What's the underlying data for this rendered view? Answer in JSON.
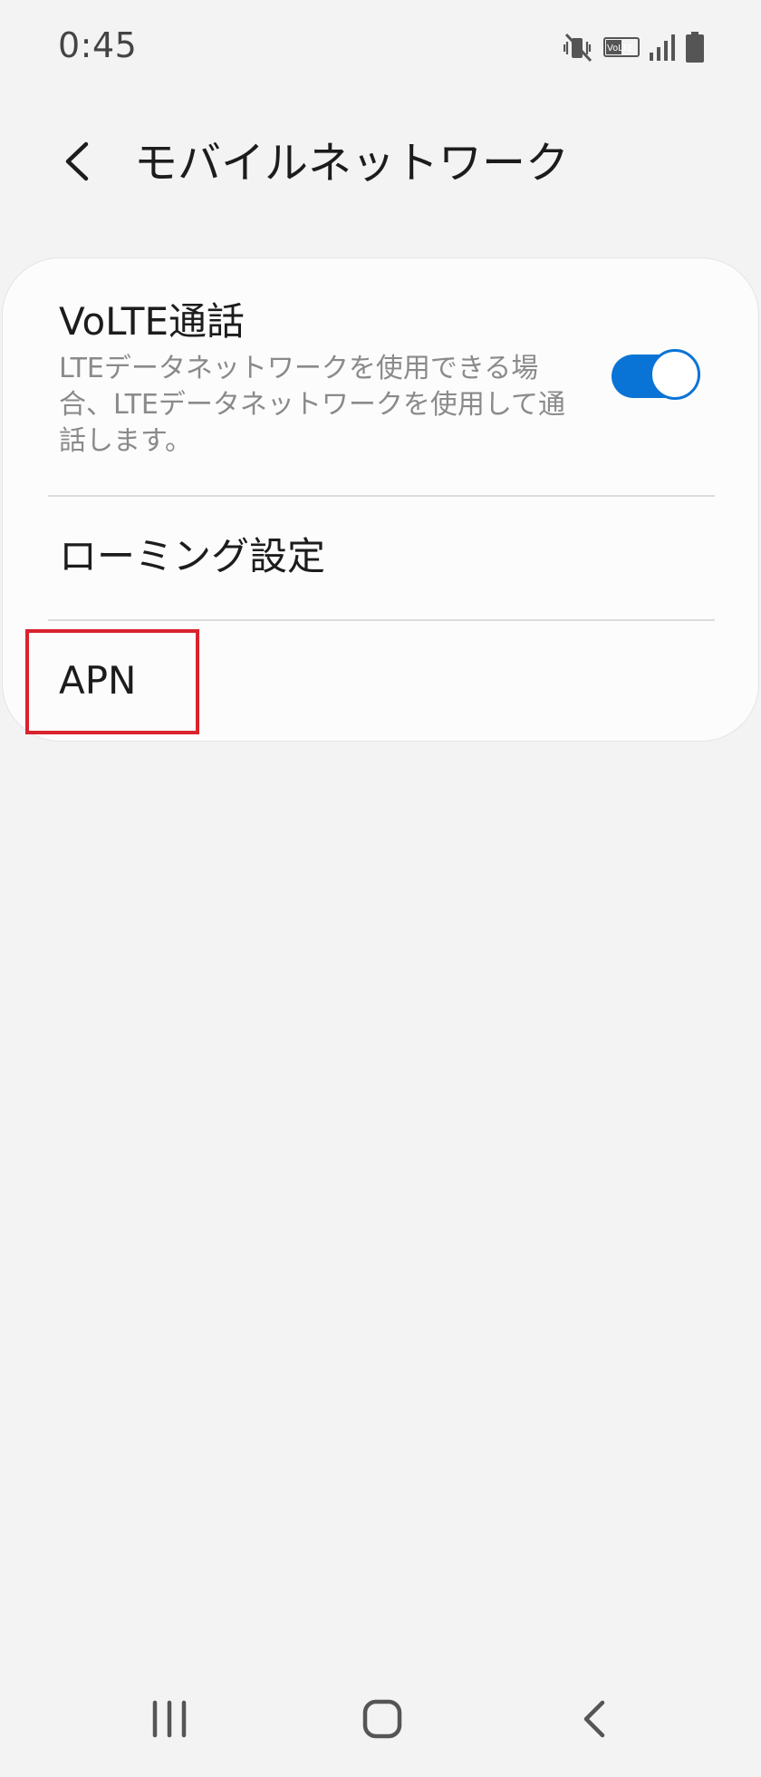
{
  "status_bar": {
    "time": "0:45",
    "icons": [
      "vibrate-mute-icon",
      "volte-icon",
      "signal-icon",
      "battery-icon"
    ],
    "volte_badge": "VoLTE"
  },
  "header": {
    "back_icon": "chevron-left-icon",
    "title": "モバイルネットワーク"
  },
  "settings": {
    "volte": {
      "title": "VoLTE通話",
      "description": "LTEデータネットワークを使用できる場合、LTEデータネットワークを使用して通話します。",
      "enabled": true
    },
    "roaming": {
      "label": "ローミング設定"
    },
    "apn": {
      "label": "APN"
    }
  },
  "colors": {
    "accent": "#0a74d6",
    "highlight": "#d9232e",
    "background": "#f3f3f3",
    "card": "#fcfcfc",
    "secondary_text": "#8a8a8a"
  },
  "nav_bar": {
    "items": [
      "recent-apps-icon",
      "home-icon",
      "back-icon"
    ]
  }
}
